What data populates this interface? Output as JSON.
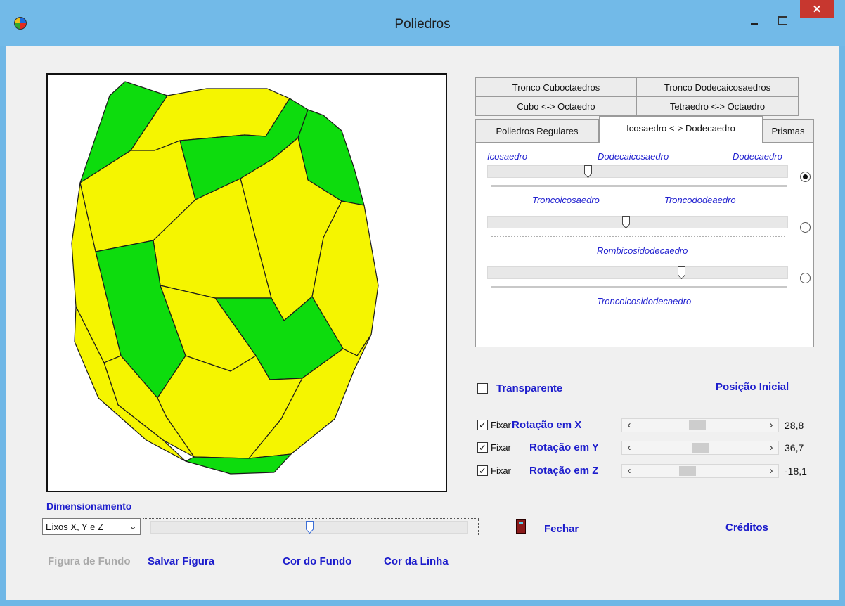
{
  "window": {
    "title": "Poliedros"
  },
  "tabs": {
    "row1": [
      "Tronco Cuboctaedros",
      "Tronco Dodecaicosaedros"
    ],
    "row2": [
      "Cubo <-> Octaedro",
      "Tetraedro <-> Octaedro"
    ],
    "row3": [
      "Poliedros Regulares",
      "Icosaedro <-> Dodecaedro",
      "Prismas"
    ],
    "active": "Icosaedro <-> Dodecaedro"
  },
  "panel": {
    "slider1_labels": [
      "Icosaedro",
      "Dodecaicosaedro",
      "Dodecaedro"
    ],
    "slider1_value": 0.33,
    "slider2_labels": [
      "Troncoicosaedro",
      "Troncododeaedro"
    ],
    "slider2_value": 0.46,
    "slider3_label_top": "Rombicosidodecaedro",
    "slider3_label_bottom": "Troncoicosidodecaedro",
    "slider3_value": 0.65,
    "selected_radio": 1
  },
  "colors": {
    "face_hex": "#f5f500",
    "face_pent": "#0ddc0d",
    "edge": "#1a1a1a",
    "label_blue": "#1d1dcc"
  },
  "controls": {
    "transparente_label": "Transparente",
    "transparente_checked": false,
    "posicao_inicial": "Posição Inicial",
    "fixar_label": "Fixar",
    "rotations": [
      {
        "label": "Rotação em X",
        "value": "28,8",
        "fixed": true,
        "position": 0.47
      },
      {
        "label": "Rotação em Y",
        "value": "36,7",
        "fixed": true,
        "position": 0.5
      },
      {
        "label": "Rotação em Z",
        "value": "-18,1",
        "fixed": true,
        "position": 0.38
      }
    ]
  },
  "dimensionamento": {
    "label": "Dimensionamento",
    "combo_value": "Eixos X, Y e Z",
    "slider_value": 0.5
  },
  "footer": {
    "figura_fundo": "Figura de Fundo",
    "salvar_figura": "Salvar Figura",
    "cor_fundo": "Cor do Fundo",
    "cor_linha": "Cor da Linha",
    "fechar": "Fechar",
    "creditos": "Créditos"
  }
}
